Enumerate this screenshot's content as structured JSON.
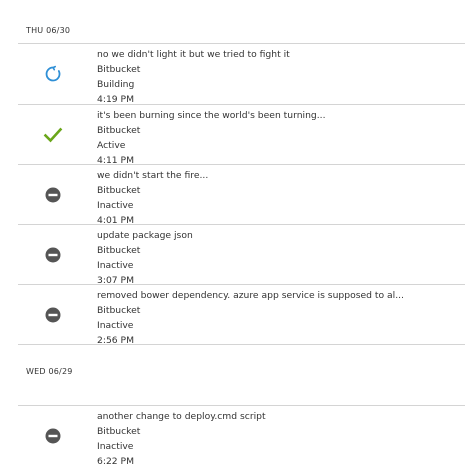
{
  "groups": [
    {
      "date": "THU 06/30",
      "items": [
        {
          "message": "no we didn't light it but we tried to fight it",
          "source": "Bitbucket",
          "status": "Building",
          "time": "4:19 PM",
          "icon": "refresh-icon",
          "color": "#2e8fd6"
        },
        {
          "message": "it's been burning since the world's been turning...",
          "source": "Bitbucket",
          "status": "Active",
          "time": "4:11 PM",
          "icon": "checkmark-icon",
          "color": "#6aa61a"
        },
        {
          "message": "we didn't start the fire...",
          "source": "Bitbucket",
          "status": "Inactive",
          "time": "4:01 PM",
          "icon": "minus-circle-icon",
          "color": "#555555"
        },
        {
          "message": "update package json",
          "source": "Bitbucket",
          "status": "Inactive",
          "time": "3:07 PM",
          "icon": "minus-circle-icon",
          "color": "#555555"
        },
        {
          "message": "removed bower dependency. azure app service is supposed to al...",
          "source": "Bitbucket",
          "status": "Inactive",
          "time": "2:56 PM",
          "icon": "minus-circle-icon",
          "color": "#555555"
        }
      ]
    },
    {
      "date": "WED 06/29",
      "items": [
        {
          "message": "another change to deploy.cmd script",
          "source": "Bitbucket",
          "status": "Inactive",
          "time": "6:22 PM",
          "icon": "minus-circle-icon",
          "color": "#555555"
        }
      ]
    }
  ]
}
